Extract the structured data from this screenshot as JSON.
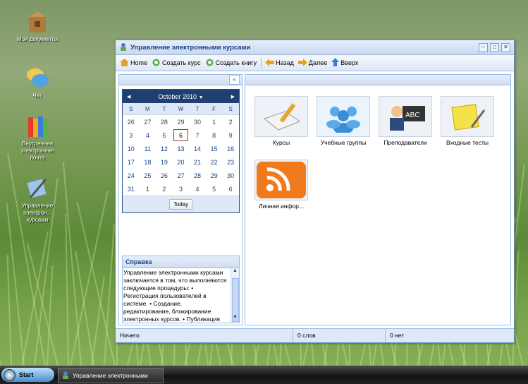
{
  "desktop": {
    "icons": [
      {
        "label": "Мои документы"
      },
      {
        "label": "Чат"
      },
      {
        "label": "Внутренняя электронная почта"
      },
      {
        "label": "Управление электрон... курсами"
      }
    ]
  },
  "window": {
    "title": "Управление электронными курсами",
    "controls": {
      "minimize": "–",
      "maximize": "□",
      "close": "✕"
    },
    "toolbar": {
      "home": "Home",
      "create_course": "Создать курс",
      "create_book": "Создать книгу",
      "back": "Назад",
      "forward": "Далее",
      "up": "Вверх"
    },
    "collapse": "«",
    "calendar": {
      "month": "October 2010",
      "prev": "◀",
      "next": "▶",
      "dropdown": "▼",
      "weekdays": [
        "S",
        "M",
        "T",
        "W",
        "T",
        "F",
        "S"
      ],
      "weeks": [
        [
          "26",
          "27",
          "28",
          "29",
          "30",
          "1",
          "2"
        ],
        [
          "3",
          "4",
          "5",
          "6",
          "7",
          "8",
          "9"
        ],
        [
          "10",
          "11",
          "12",
          "13",
          "14",
          "15",
          "16"
        ],
        [
          "17",
          "18",
          "19",
          "20",
          "21",
          "22",
          "23"
        ],
        [
          "24",
          "25",
          "26",
          "27",
          "28",
          "29",
          "30"
        ],
        [
          "31",
          "1",
          "2",
          "3",
          "4",
          "5",
          "6"
        ]
      ],
      "today_label": "Today",
      "selected_day": "6"
    },
    "help": {
      "title": "Справка",
      "text": "Управление электронными курсами заключается в том, что выполняются следующие процедуры: • Регистрация пользователей в системе. • Создание, редактирование, блокирование электронных курсов. • Публикация учебных материалов лекции, книг, заданий, тестов. • Моделирование процесса обучения"
    },
    "tiles": [
      {
        "label": "Курсы"
      },
      {
        "label": "Учебные группы"
      },
      {
        "label": "Преподаватели"
      },
      {
        "label": "Входные тесты"
      },
      {
        "label": "Личная инфор..."
      }
    ],
    "status": {
      "left": "Ничего",
      "middle": "0 слов",
      "right": "0 нет"
    }
  },
  "taskbar": {
    "start": "Start",
    "task": "Управление электронными"
  },
  "colors": {
    "accent": "#15428b",
    "panel_border": "#99bbe8",
    "calendar_header": "#1f3f72"
  }
}
